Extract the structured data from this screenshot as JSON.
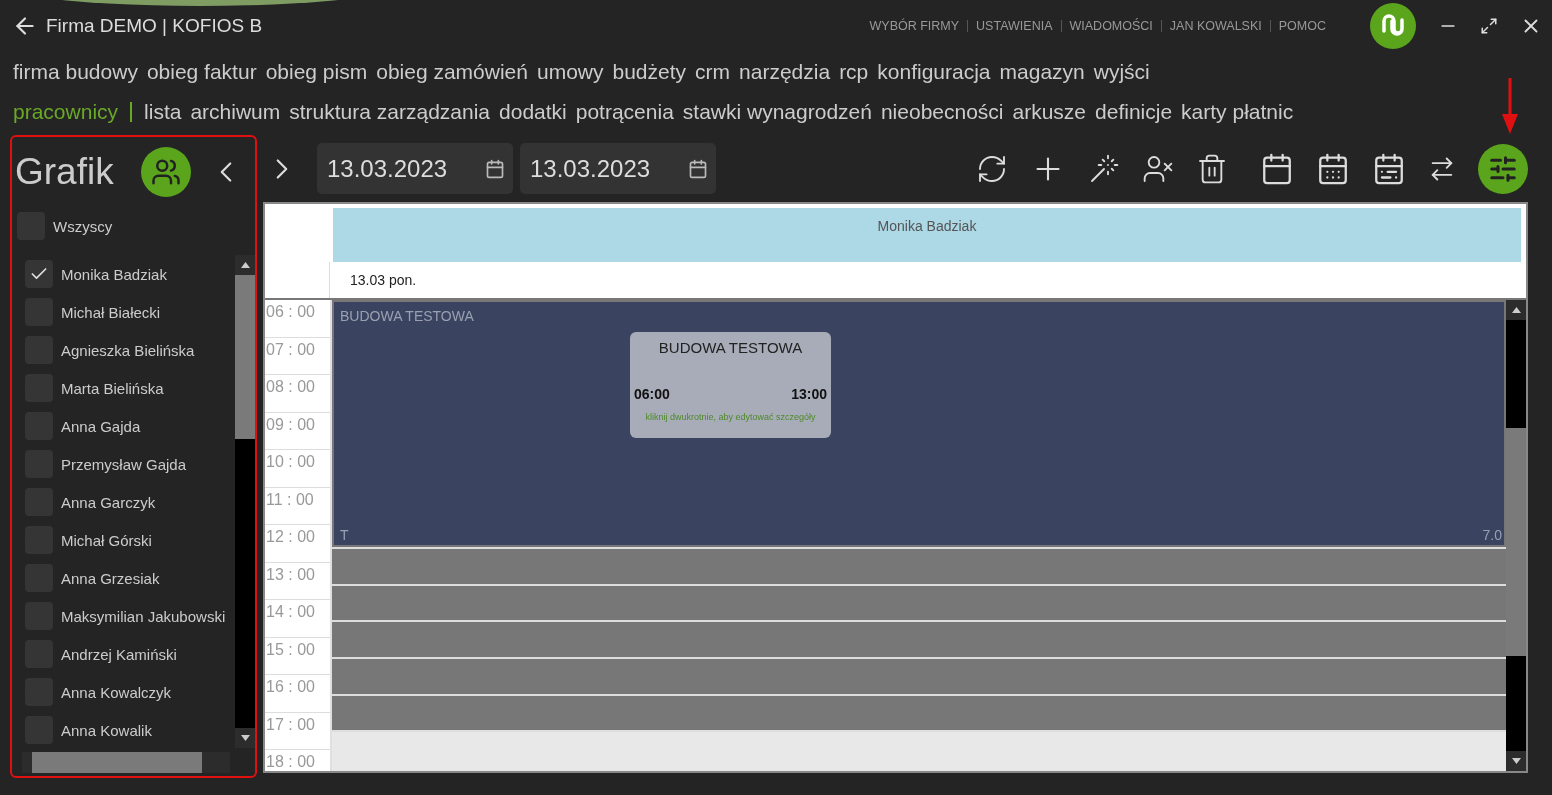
{
  "window": {
    "title": "Firma DEMO | KOFIOS B",
    "links": [
      "WYBÓR FIRMY",
      "USTAWIENIA",
      "WIADOMOŚCI",
      "JAN KOWALSKI",
      "POMOC"
    ]
  },
  "menu": {
    "items": [
      "firma budowy",
      "obieg faktur",
      "obieg pism",
      "obieg zamówień",
      "umowy",
      "budżety",
      "crm",
      "narzędzia",
      "rcp",
      "konfiguracja",
      "magazyn",
      "wyjści"
    ]
  },
  "submenu": {
    "section": "pracownicy",
    "items": [
      "lista",
      "archiwum",
      "struktura zarządzania",
      "dodatki",
      "potrącenia",
      "stawki wynagrodzeń",
      "nieobecności",
      "arkusze",
      "definicje",
      "karty płatnic"
    ]
  },
  "sidebar": {
    "title": "Grafik",
    "all": {
      "label": "Wszyscy",
      "checked": false
    },
    "employees": [
      {
        "name": "Monika Badziak",
        "checked": true
      },
      {
        "name": "Michał Białecki",
        "checked": false
      },
      {
        "name": "Agnieszka Bielińska",
        "checked": false
      },
      {
        "name": "Marta Bielińska",
        "checked": false
      },
      {
        "name": "Anna Gajda",
        "checked": false
      },
      {
        "name": "Przemysław Gajda",
        "checked": false
      },
      {
        "name": "Anna  Garczyk",
        "checked": false
      },
      {
        "name": "Michał Górski",
        "checked": false
      },
      {
        "name": "Anna Grzesiak",
        "checked": false
      },
      {
        "name": "Maksymilian Jakubowski",
        "checked": false
      },
      {
        "name": "Andrzej Kamiński",
        "checked": false
      },
      {
        "name": "Anna Kowalczyk",
        "checked": false
      },
      {
        "name": "Anna Kowalik",
        "checked": false
      }
    ]
  },
  "toolbar": {
    "date_from": "13.03.2023",
    "date_to": "13.03.2023"
  },
  "schedule": {
    "employee": "Monika Badziak",
    "day": "13.03 pon.",
    "hours": [
      "06 : 00",
      "07 : 00",
      "08 : 00",
      "09 : 00",
      "10 : 00",
      "11 : 00",
      "12 : 00",
      "13 : 00",
      "14 : 00",
      "15 : 00",
      "16 : 00",
      "17 : 00",
      "18 : 00"
    ],
    "block": {
      "label": "BUDOWA TESTOWA",
      "corner": "T",
      "edge": "7.0"
    },
    "event": {
      "title": "BUDOWA TESTOWA",
      "start": "06:00",
      "end": "13:00",
      "hint": "kliknij dwukrotnie, aby edytować szczegóły"
    }
  }
}
